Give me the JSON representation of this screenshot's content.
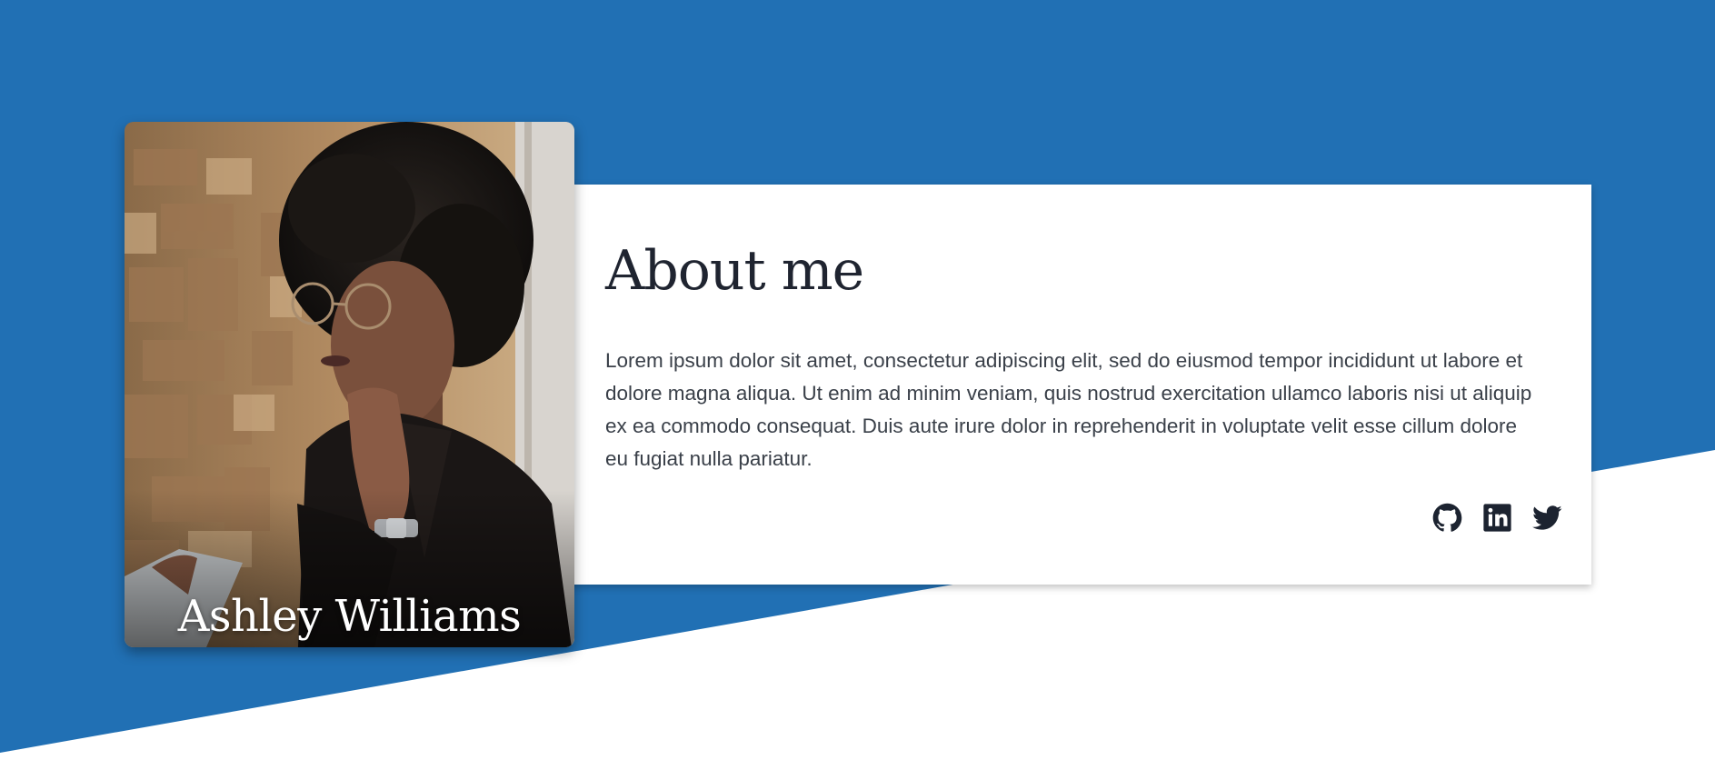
{
  "profile": {
    "name": "Ashley Williams",
    "photo_alt": "Ashley Williams"
  },
  "about": {
    "title": "About me",
    "text": "Lorem ipsum dolor sit amet, consectetur adipiscing elit, sed do eiusmod tempor incididunt ut labore et dolore magna aliqua. Ut enim ad minim veniam, quis nostrud exercitation ullamco laboris nisi ut aliquip ex ea commodo consequat. Duis aute irure dolor in reprehenderit in voluptate velit esse cillum dolore eu fugiat nulla pariatur."
  },
  "socials": [
    {
      "icon": "github-icon"
    },
    {
      "icon": "linkedin-icon"
    },
    {
      "icon": "twitter-icon"
    }
  ],
  "colors": {
    "brand_blue": "#2170b4",
    "text_dark": "#1f2430",
    "body_text": "#3a4049",
    "icon_color": "#1c2330"
  }
}
